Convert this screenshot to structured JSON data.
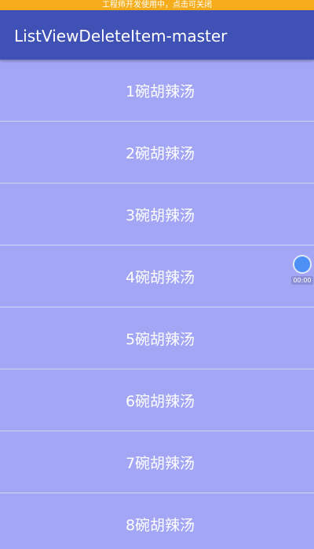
{
  "status_bar": {
    "notice": "工程师开发使用中，点击可关闭"
  },
  "app_bar": {
    "title": "ListViewDeleteItem-master"
  },
  "list": {
    "items": [
      {
        "label": "1碗胡辣汤"
      },
      {
        "label": "2碗胡辣汤"
      },
      {
        "label": "3碗胡辣汤"
      },
      {
        "label": "4碗胡辣汤"
      },
      {
        "label": "5碗胡辣汤"
      },
      {
        "label": "6碗胡辣汤"
      },
      {
        "label": "7碗胡辣汤"
      },
      {
        "label": "8碗胡辣汤"
      }
    ]
  },
  "floating_widget": {
    "time": "00:00"
  },
  "colors": {
    "status_bar": "#f5ad1b",
    "app_bar": "#3f51b5",
    "list_background": "#a3a6f5",
    "divider": "#d6d8fb",
    "widget": "#4d8ff5"
  }
}
